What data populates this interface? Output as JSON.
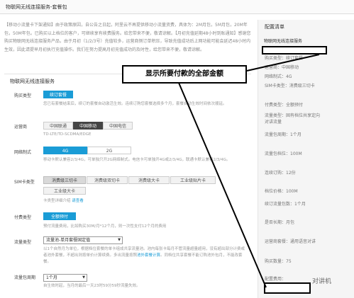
{
  "header": {
    "title": "物联网无线连接服务-套餐包"
  },
  "notice": "【移动小流量卡下架通知】由于政策原因，自公告之日起，阿里云不再提供移动小流量资费，具体为：2M月包，5M月包，20M年包，50M年包。已购买以上档位的客户，可继续享有续费服务。给您带来不便，敬请谅解。【月初充值延期48小时到账通知】感谢您购买物联网无线连接服务产品，由于月初（1/2/3号）充值较多，运营商侧订单积压，导致充值成功后上网功能可能会延迟48小时内生效，因此请提早月初执行充值操作。我们在努力提高月初充值成功的及时性，给您带来不便，敬请谅解。",
  "section_title": "物联网无线连接服务",
  "form": {
    "purchase_type": {
      "label": "购买类型",
      "button": "续订套餐",
      "hint": "您已有套餐结束后，续订的套餐自动激活生效。连续订购您套餐选择多个月，套餐自动生效时间依次顺延。"
    },
    "carrier": {
      "label": "运营商",
      "options": [
        "中国联通",
        "中国移动",
        "中国电信"
      ],
      "selected": "中国移动",
      "hint": "TD-LTE/TD-SCDMA/EDGE"
    },
    "network": {
      "label": "网络制式",
      "options": [
        "4G",
        "2G"
      ],
      "selected": "4G",
      "hint": "移动卡默认兼容2/3/4G，可单独只开2G网络制式。电信卡可单独开4G或2/3/4G，联通卡默认兼容2/3/4G。"
    },
    "sim_type": {
      "label": "SIM卡类型",
      "options": [
        "消费级三切卡",
        "消费级双切卡",
        "消费级大卡",
        "工业级贴片卡",
        "工业级大卡"
      ],
      "selected": "消费级三切卡",
      "hint": "卡类型详细介绍",
      "link": "请查看"
    },
    "pay_type": {
      "label": "付费类型",
      "button": "全额预付",
      "hint": "预付流量费用，比如购买30M/月*12个月，则一次性支付12个月的费用"
    },
    "flow_type": {
      "label": "流量类型",
      "value": "流量池-单月套餐固定值",
      "hint": "以1个自然月为单位，根据档位套餐的单卡组成共享流量池。池内每张卡每月不管流量超量超用，没有超出部分计费或者池外套餐，不超出则按单价计算续费。多出流量按照",
      "hint_link": "池外套餐计算",
      "hint2": "。同档位共享套餐不能订购池外包月，不能改套餐。"
    },
    "period": {
      "label": "流量包周期",
      "value": "1个月",
      "hint": "自生效时起，当月的最后一天23时59分59秒流量失效。"
    }
  },
  "sidebar": {
    "title": "配置清单",
    "subtitle": "物联网无线连接服务",
    "rows": [
      "购买类型：续订套餐",
      "运营商：中国移动",
      "网络制式：4G",
      "SIM卡类型：消费级三切卡",
      "付费类型：全额预付",
      "流量类型：固有档位共享定向对讲流量",
      "流量包周期：1个月",
      "流量包档位：100M",
      "连续订购：12份",
      "档位价格：100M",
      "续订流量包数：1个月",
      "是否长期：月包",
      "运营商套餐：通用语音对讲",
      "购买数量：75"
    ],
    "total_label": "配置费用："
  },
  "callout": "显示所要付款的全部金额",
  "watermark": "对讲机"
}
